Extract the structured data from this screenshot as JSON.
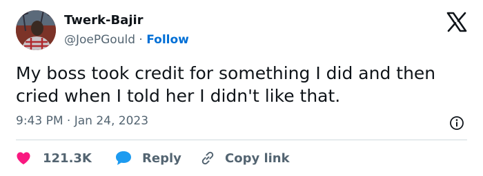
{
  "author": {
    "display_name": "Twerk-Bajir",
    "handle": "@JoePGould",
    "separator": " · ",
    "follow_label": "Follow"
  },
  "tweet": {
    "text_line1": "My boss took credit for something I did and then",
    "text_line2": "cried when I told her I didn't like that.",
    "time": "9:43 PM · Jan 24, 2023"
  },
  "actions": {
    "likes_count": "121.3K",
    "reply_label": "Reply",
    "copy_link_label": "Copy link"
  },
  "icons": {
    "platform": "x-logo-icon",
    "info": "info-icon",
    "like": "heart-icon",
    "reply": "speech-bubble-icon",
    "copy": "link-icon"
  },
  "colors": {
    "like": "#f91880",
    "reply": "#1d9bf0",
    "follow": "#006fd6",
    "muted": "#536471"
  }
}
